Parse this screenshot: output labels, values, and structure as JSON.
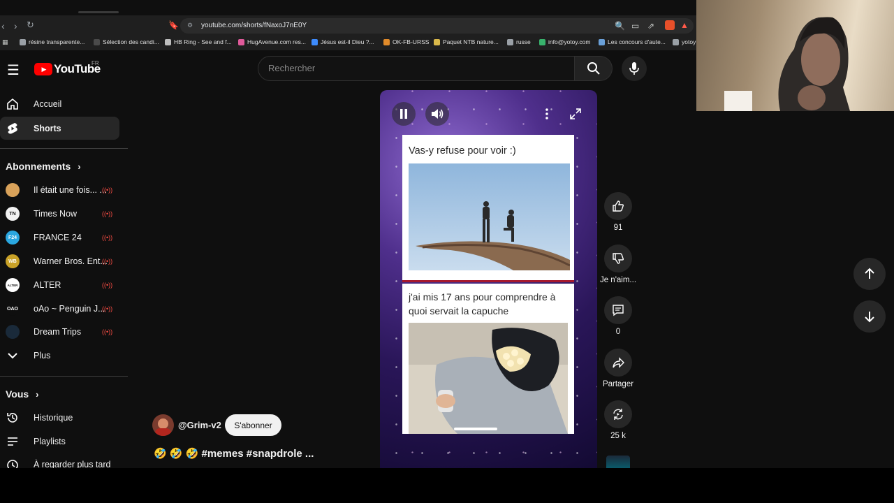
{
  "browser": {
    "url": "youtube.com/shorts/fNaxoJ7nE0Y",
    "bookmarks": [
      {
        "label": "résine transparente...",
        "color": "#9aa0a6"
      },
      {
        "label": "Sélection des candi...",
        "color": "#4a4a4a"
      },
      {
        "label": "HB Ring - See and f...",
        "color": "#bdbdbd"
      },
      {
        "label": "HugAvenue.com res...",
        "color": "#e05a9a"
      },
      {
        "label": "Jésus est-il Dieu ?...",
        "color": "#3d8bfd"
      },
      {
        "label": "OK-FB-URSS",
        "color": "#e08a2a"
      },
      {
        "label": "Paquet NTB nature...",
        "color": "#d9b84a"
      },
      {
        "label": "russe",
        "color": "#9aa0a6"
      },
      {
        "label": "info@yotoy.com",
        "color": "#38b26c"
      },
      {
        "label": "Les concours d'aute...",
        "color": "#6aa0d8"
      },
      {
        "label": "yotoy",
        "color": "#9aa0a6"
      }
    ]
  },
  "header": {
    "logo_text": "YouTube",
    "region": "FR",
    "search_placeholder": "Rechercher"
  },
  "sidebar": {
    "main": [
      {
        "label": "Accueil",
        "icon": "home-icon"
      },
      {
        "label": "Shorts",
        "icon": "shorts-icon",
        "active": true
      }
    ],
    "subscriptions_title": "Abonnements",
    "subscriptions": [
      {
        "label": "Il était une fois... ...",
        "avatar_color": "#d9a25a",
        "avatar_text": ""
      },
      {
        "label": "Times Now",
        "avatar_color": "#f2f2f2",
        "avatar_text": "TN"
      },
      {
        "label": "FRANCE 24",
        "avatar_color": "#2aa7e0",
        "avatar_text": "F24"
      },
      {
        "label": "Warner Bros. Ent...",
        "avatar_color": "#c9a227",
        "avatar_text": "WB"
      },
      {
        "label": "ALTER",
        "avatar_color": "#ffffff",
        "avatar_text": "ALTER"
      },
      {
        "label": "oAo ~ Penguin J...",
        "avatar_color": "#0f0f0f",
        "avatar_text": "OAO"
      },
      {
        "label": "Dream Trips",
        "avatar_color": "#1a2a3a",
        "avatar_text": ""
      }
    ],
    "more_label": "Plus",
    "you_title": "Vous",
    "you_items": [
      {
        "label": "Historique",
        "icon": "history-icon"
      },
      {
        "label": "Playlists",
        "icon": "playlists-icon"
      },
      {
        "label": "À regarder plus tard",
        "icon": "watch-later-icon"
      }
    ]
  },
  "short": {
    "meme1_caption": "Vas-y refuse pour voir :)",
    "meme2_caption": "j'ai mis 17 ans pour comprendre à quoi servait la capuche",
    "channel": "@Grim-v2",
    "subscribe_label": "S'abonner",
    "title": "🤣 🤣 🤣 #memes #snapdrole ..."
  },
  "actions": {
    "likes": "91",
    "dislike_label": "Je n'aim...",
    "comments": "0",
    "share_label": "Partager",
    "remix": "25 k"
  }
}
